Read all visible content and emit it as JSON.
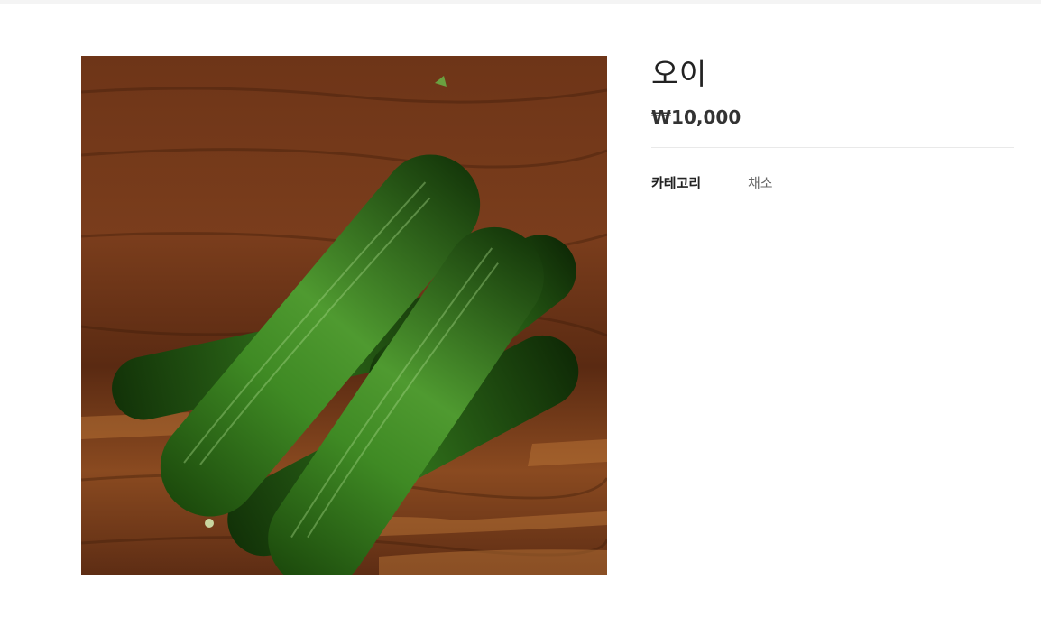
{
  "product": {
    "name": "오이",
    "price": "₩10,000",
    "image_subject": "cucumbers on wooden board"
  },
  "details": [
    {
      "label": "카테고리",
      "value": "채소"
    }
  ],
  "colors": {
    "cucumber_green": "#2d6a17",
    "wood_brown": "#6b3416",
    "text": "#222222",
    "muted": "#666666"
  }
}
